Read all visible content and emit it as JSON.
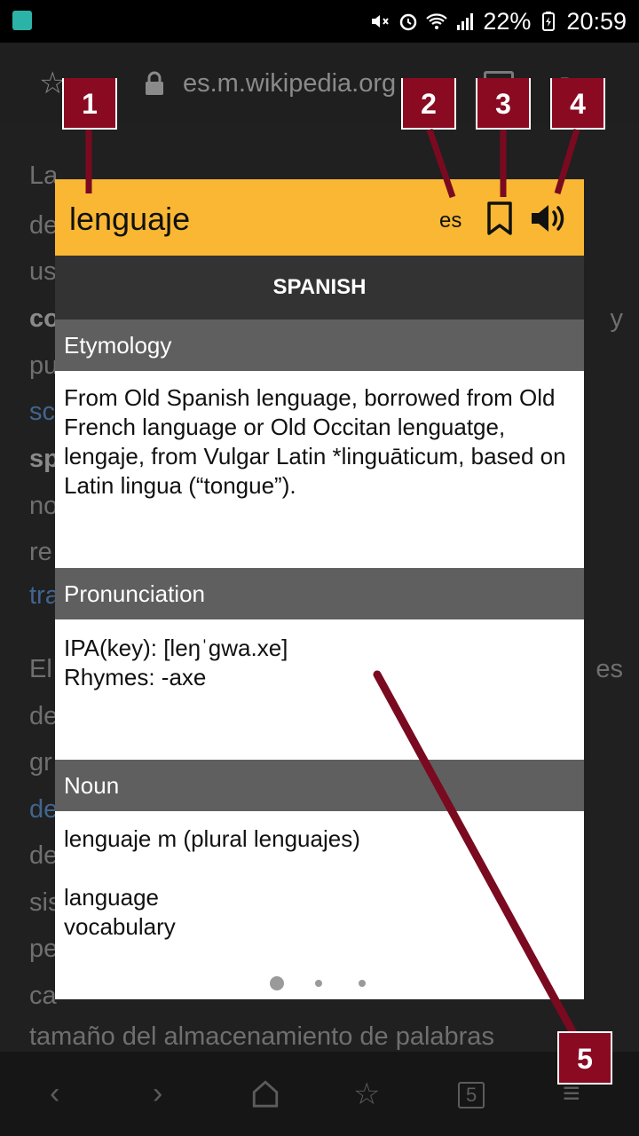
{
  "status_bar": {
    "battery": "22%",
    "time": "20:59"
  },
  "browser": {
    "url": "es.m.wikipedia.org"
  },
  "background_page": {
    "lines": [
      "La",
      "de",
      "us",
      "co",
      "pu",
      "sc",
      "sp",
      "no",
      "re",
      "tra",
      "El",
      "de",
      "gr",
      "de",
      "de",
      "sis",
      "pe",
      "ca"
    ],
    "bottom_line": "tamaño del almacenamiento de palabras"
  },
  "popup": {
    "word": "lenguaje",
    "lang_code": "es",
    "language_title": "SPANISH",
    "sections": [
      {
        "heading": "Etymology",
        "body": "From Old Spanish lenguage, borrowed from Old French language or Old Occitan lenguatge, lengaje, from Vulgar Latin *linguāticum, based on Latin lingua (“tongue”)."
      },
      {
        "heading": "Pronunciation",
        "line1": "IPA(key): [leŋˈgwa.xe]",
        "line2": "Rhymes: -axe"
      },
      {
        "heading": "Noun",
        "line1": "lenguaje m (plural lenguajes)",
        "sense1": "language",
        "sense2": "vocabulary"
      }
    ],
    "page_dots_total": 3,
    "page_dots_active": 1
  },
  "annotations": [
    "1",
    "2",
    "3",
    "4",
    "5"
  ],
  "colors": {
    "header_yellow": "#f9b733",
    "section_gray": "#5f5f5f",
    "language_bar": "#333333",
    "annotation_red": "#8a0a22"
  },
  "bottom_nav": {
    "tabs_count": "5"
  }
}
